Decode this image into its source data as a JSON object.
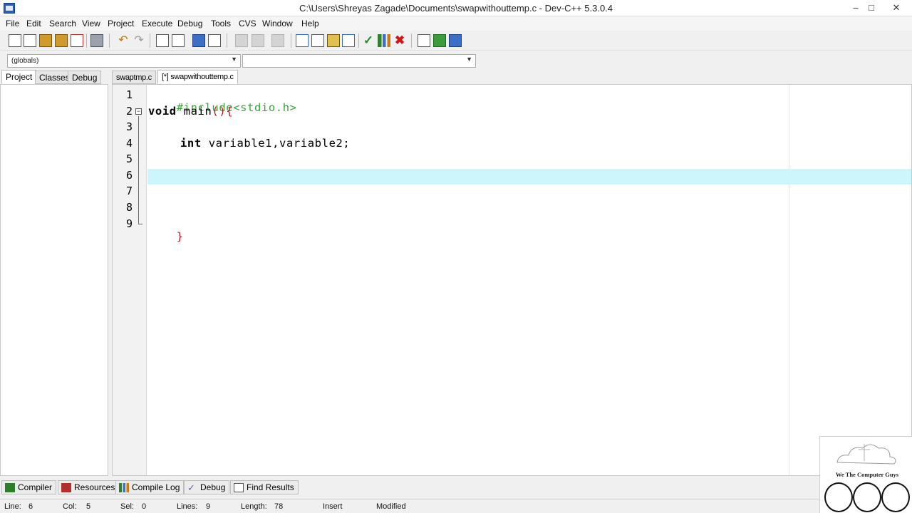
{
  "window": {
    "title": "C:\\Users\\Shreyas Zagade\\Documents\\swapwithouttemp.c - Dev-C++ 5.3.0.4",
    "minimize": "‒",
    "maximize": "□",
    "close": "✕"
  },
  "menu": [
    "File",
    "Edit",
    "Search",
    "View",
    "Project",
    "Execute",
    "Debug",
    "Tools",
    "CVS",
    "Window",
    "Help"
  ],
  "toolbar_icons": [
    "new-file-icon",
    "open-file-icon",
    "save-icon",
    "save-all-icon",
    "close-file-icon",
    "print-icon",
    "undo-icon",
    "redo-icon",
    "find-icon",
    "replace-icon",
    "goto-line-icon",
    "new-class-icon",
    "indent-icon",
    "unindent-icon",
    "toggle-bookmark-icon",
    "new-project-icon",
    "project-options-icon",
    "insert-icon",
    "class-browser-icon",
    "compile-icon",
    "compile-run-icon",
    "stop-icon",
    "debug-icon",
    "run-icon",
    "rebuild-icon"
  ],
  "combos": {
    "scope": "(globals)",
    "members": ""
  },
  "left_tabs": [
    "Project",
    "Classes",
    "Debug"
  ],
  "editor_tabs": [
    "swaptmp.c",
    "[*] swapwithouttemp.c"
  ],
  "editor": {
    "line_numbers": [
      "1",
      "2",
      "3",
      "4",
      "5",
      "6",
      "7",
      "8",
      "9"
    ],
    "fold_open": "−",
    "current_line": 6,
    "code": {
      "line1": "#include<stdio.h>",
      "line2_kw": "void",
      "line2_rest": " main",
      "line2_punct": "(){",
      "line4_kw": "int",
      "line4_rest": " variable1,variable2;",
      "line9": "}"
    }
  },
  "bottom_tabs": [
    "Compiler",
    "Resources",
    "Compile Log",
    "Debug",
    "Find Results"
  ],
  "status": {
    "line_label": "Line:",
    "line_value": "6",
    "col_label": "Col:",
    "col_value": "5",
    "sel_label": "Sel:",
    "sel_value": "0",
    "lines_label": "Lines:",
    "lines_value": "9",
    "length_label": "Length:",
    "length_value": "78",
    "mode": "Insert",
    "state": "Modified"
  },
  "watermark": {
    "text": "We The Computer Guys"
  },
  "colors": {
    "current_line": "#ccf6fc",
    "preprocessor": "#3f9f3f",
    "brace": "#b51a1a"
  }
}
